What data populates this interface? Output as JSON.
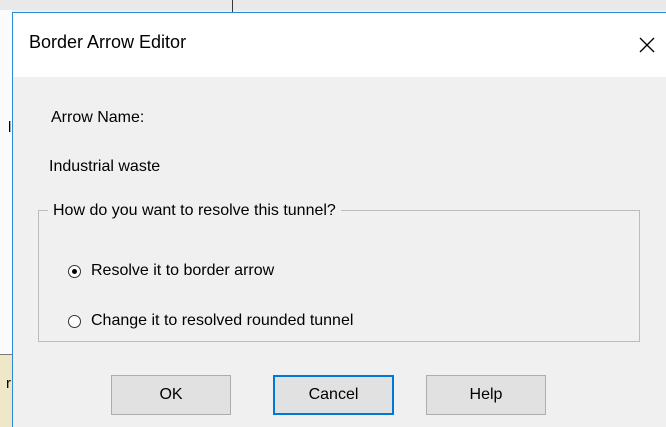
{
  "background": {
    "text_1": "li",
    "text_2": "r"
  },
  "dialog": {
    "title": "Border Arrow Editor",
    "close_icon": "close-icon",
    "arrow_name_label": "Arrow Name:",
    "arrow_name_value": "Industrial waste",
    "group": {
      "legend": "How do you want to resolve this tunnel?",
      "options": [
        {
          "label": "Resolve it to border arrow",
          "checked": true
        },
        {
          "label": "Change it to resolved rounded tunnel",
          "checked": false
        }
      ]
    },
    "buttons": {
      "ok": "OK",
      "cancel": "Cancel",
      "help": "Help"
    }
  },
  "colors": {
    "accent": "#0078d7",
    "dialog_border": "#2b8bd6",
    "dialog_bg": "#f0f0f0",
    "titlebar_bg": "#ffffff"
  }
}
